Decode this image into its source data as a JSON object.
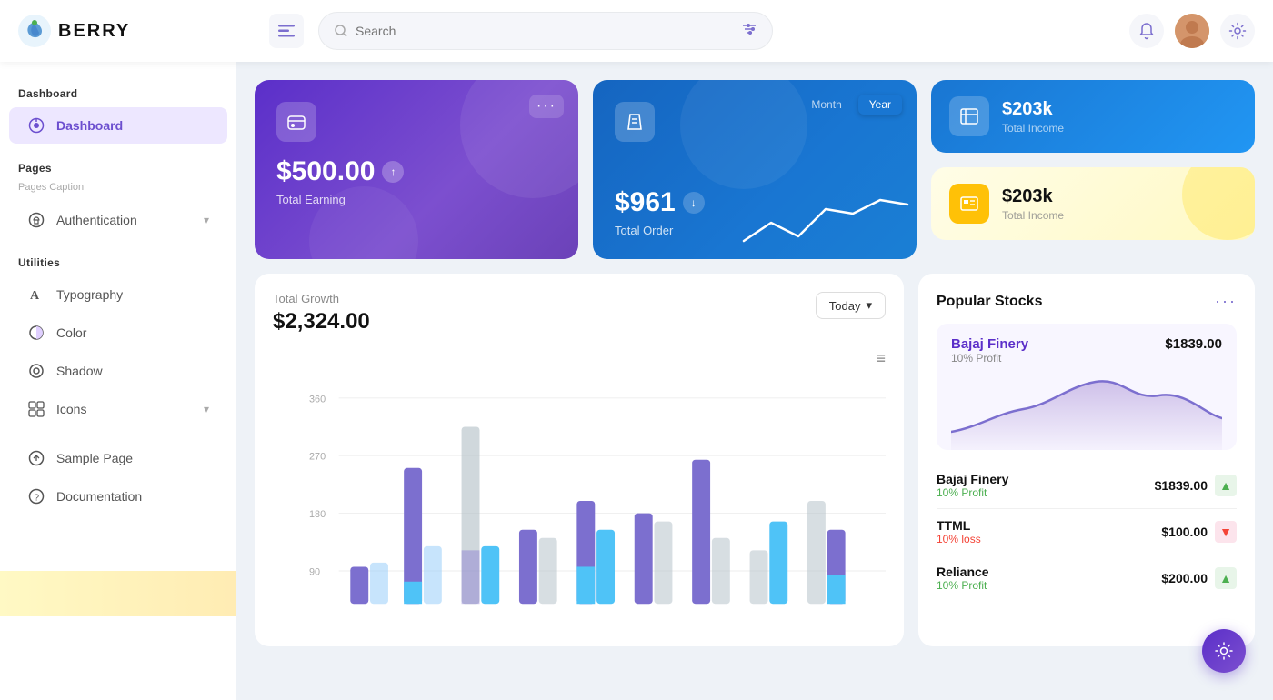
{
  "header": {
    "logo_text": "BERRY",
    "search_placeholder": "Search",
    "hamburger_label": "menu"
  },
  "sidebar": {
    "section_dashboard": "Dashboard",
    "dashboard_item": "Dashboard",
    "section_pages": "Pages",
    "pages_caption": "Pages Caption",
    "auth_item": "Authentication",
    "section_utilities": "Utilities",
    "typography_item": "Typography",
    "color_item": "Color",
    "shadow_item": "Shadow",
    "icons_item": "Icons",
    "sample_page_item": "Sample Page",
    "documentation_item": "Documentation"
  },
  "cards": {
    "earning_amount": "$500.00",
    "earning_label": "Total Earning",
    "order_amount": "$961",
    "order_label": "Total Order",
    "month_btn": "Month",
    "year_btn": "Year",
    "income_blue_amount": "$203k",
    "income_blue_label": "Total Income",
    "income_yellow_amount": "$203k",
    "income_yellow_label": "Total Income"
  },
  "growth_chart": {
    "label": "Total Growth",
    "amount": "$2,324.00",
    "today_btn": "Today",
    "y_labels": [
      "360",
      "270",
      "180",
      "90"
    ],
    "menu_icon": "≡"
  },
  "stocks": {
    "title": "Popular Stocks",
    "featured_name": "Bajaj Finery",
    "featured_price": "$1839.00",
    "featured_profit": "10% Profit",
    "items": [
      {
        "name": "Bajaj Finery",
        "profit": "10% Profit",
        "profit_type": "green",
        "price": "$1839.00",
        "direction": "up"
      },
      {
        "name": "TTML",
        "profit": "10% loss",
        "profit_type": "red",
        "price": "$100.00",
        "direction": "down"
      },
      {
        "name": "Reliance",
        "profit": "10% Profit",
        "profit_type": "green",
        "price": "$200.00",
        "direction": "up"
      }
    ]
  }
}
